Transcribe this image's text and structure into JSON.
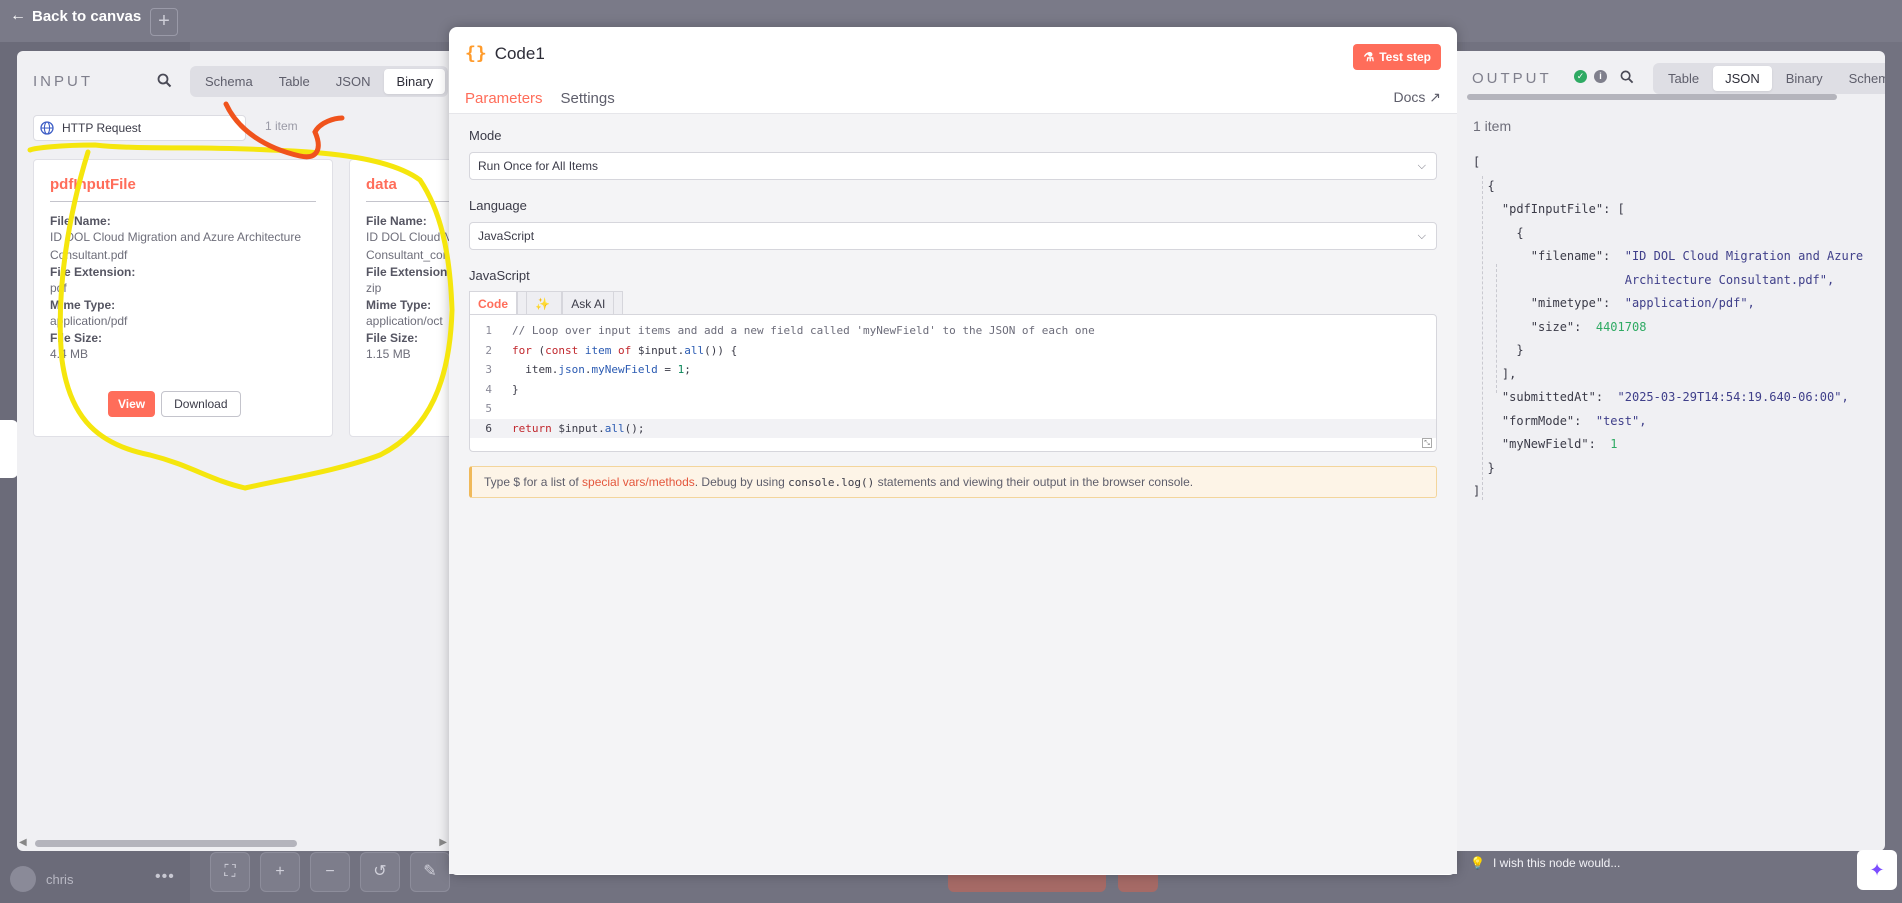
{
  "background": {
    "back_label": "Back to canvas",
    "user_name": "chris"
  },
  "input": {
    "title": "INPUT",
    "tabs": [
      "Schema",
      "Table",
      "JSON",
      "Binary"
    ],
    "active_tab": "Binary",
    "source_node": "HTTP Request",
    "items_count": "1 item",
    "binaries": [
      {
        "name": "pdfInputFile",
        "file_name_label": "File Name:",
        "file_name": "ID DOL Cloud Migration and Azure Architecture Consultant.pdf",
        "ext_label": "File Extension:",
        "ext": "pdf",
        "mime_label": "Mime Type:",
        "mime": "application/pdf",
        "size_label": "File Size:",
        "size": "4.4 MB",
        "view_label": "View",
        "download_label": "Download"
      },
      {
        "name": "data",
        "file_name_label": "File Name:",
        "file_name": "ID DOL Cloud M Consultant_con",
        "ext_label": "File Extension:",
        "ext": "zip",
        "mime_label": "Mime Type:",
        "mime": "application/oct",
        "size_label": "File Size:",
        "size": "1.15 MB"
      }
    ]
  },
  "node": {
    "name": "Code1",
    "test_step_label": "Test step",
    "tabs": [
      "Parameters",
      "Settings"
    ],
    "docs_label": "Docs",
    "mode_label": "Mode",
    "mode_value": "Run Once for All Items",
    "language_label": "Language",
    "language_value": "JavaScript",
    "code_section_label": "JavaScript",
    "code_tab": "Code",
    "ask_ai_tab": "Ask AI",
    "code_lines": [
      "// Loop over input items and add a new field called 'myNewField' to the JSON of each one",
      "for (const item of $input.all()) {",
      "  item.json.myNewField = 1;",
      "}",
      "",
      "return $input.all();"
    ],
    "hint_prefix": "Type $ for a list of ",
    "hint_link": "special vars/methods",
    "hint_mid": ". Debug by using ",
    "hint_code": "console.log()",
    "hint_suffix": " statements and viewing their output in the browser console."
  },
  "output": {
    "title": "OUTPUT",
    "tabs": [
      "Table",
      "JSON",
      "Binary",
      "Schema"
    ],
    "active_tab": "JSON",
    "items_count": "1 item",
    "json_lines": [
      "[",
      "  {",
      "    \"pdfInputFile\": [",
      "      {",
      "        \"filename\":  \"ID DOL Cloud Migration and Azure",
      "                     Architecture Consultant.pdf\",",
      "        \"mimetype\":  \"application/pdf\",",
      "        \"size\":  4401708",
      "      }",
      "    ],",
      "    \"submittedAt\":  \"2025-03-29T14:54:19.640-06:00\",",
      "    \"formMode\":  \"test\",",
      "    \"myNewField\":  1",
      "  }",
      "]"
    ],
    "wish_label": "I wish this node would..."
  },
  "colors": {
    "accent": "#ff6d5a",
    "annotation_yellow": "#f5e60d",
    "annotation_orange": "#f0531c"
  }
}
